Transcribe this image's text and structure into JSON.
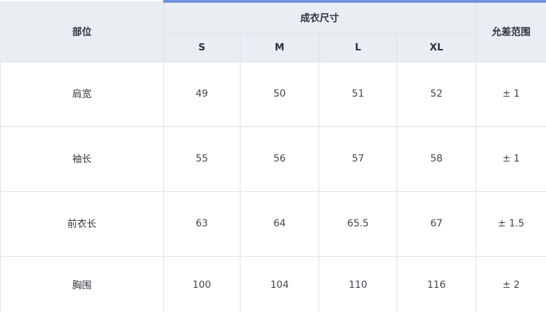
{
  "table": {
    "header": {
      "part_label": "部位",
      "group_label": "成衣尺寸",
      "tolerance_label": "允差范围",
      "sizes": [
        "S",
        "M",
        "L",
        "XL"
      ]
    },
    "rows": [
      {
        "part": "肩宽",
        "values": [
          "49",
          "50",
          "51",
          "52"
        ],
        "tolerance": "± 1"
      },
      {
        "part": "袖长",
        "values": [
          "55",
          "56",
          "57",
          "58"
        ],
        "tolerance": "± 1"
      },
      {
        "part": "前衣长",
        "values": [
          "63",
          "64",
          "65.5",
          "67"
        ],
        "tolerance": "± 1.5"
      },
      {
        "part": "胸围",
        "values": [
          "100",
          "104",
          "110",
          "116"
        ],
        "tolerance": "± 2"
      }
    ]
  },
  "colors": {
    "header_bg": "#eaedf2",
    "accent": "#6f91de",
    "border": "#dde1e7"
  }
}
